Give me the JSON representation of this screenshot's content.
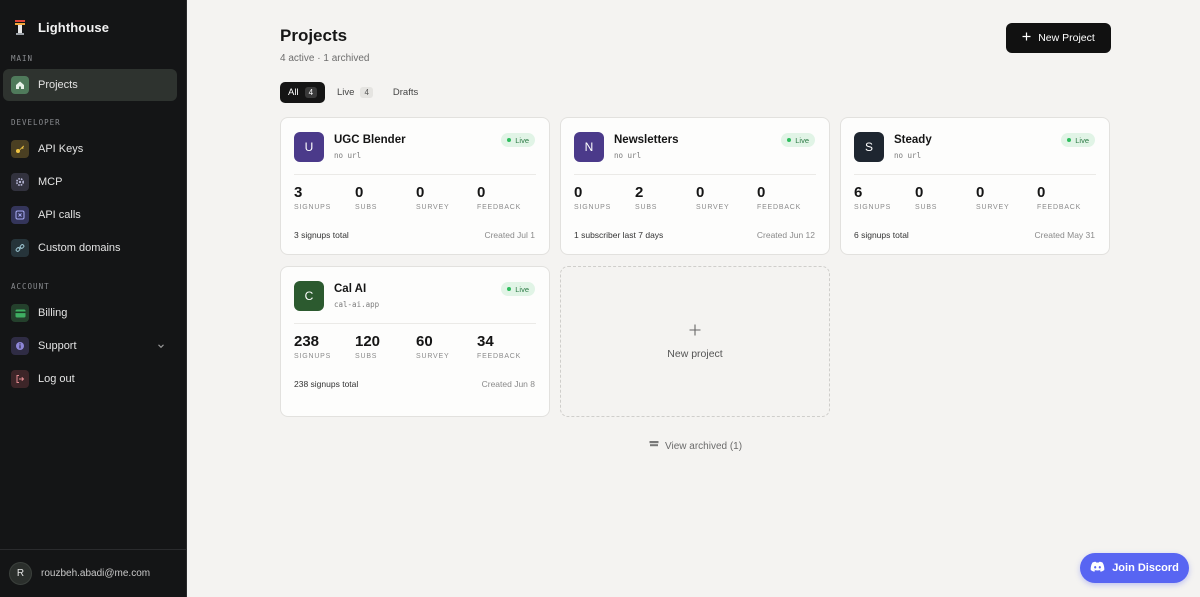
{
  "app": {
    "name": "Lighthouse"
  },
  "sidebar": {
    "sections": {
      "main": "MAIN",
      "developer": "DEVELOPER",
      "account": "ACCOUNT"
    },
    "items": {
      "projects": "Projects",
      "api_keys": "API Keys",
      "mcp": "MCP",
      "api_calls": "API calls",
      "custom_domains": "Custom domains",
      "billing": "Billing",
      "support": "Support",
      "log_out": "Log out"
    },
    "user": {
      "initial": "R",
      "email": "rouzbeh.abadi@me.com"
    }
  },
  "header": {
    "title": "Projects",
    "subtitle": "4 active · 1 archived",
    "new_project_label": "New Project"
  },
  "tabs": [
    {
      "label": "All",
      "count": "4"
    },
    {
      "label": "Live",
      "count": "4"
    },
    {
      "label": "Drafts"
    }
  ],
  "projects": [
    {
      "initial": "U",
      "name": "UGC Blender",
      "url": "no url",
      "status": "Live",
      "color": "#4b3a8a",
      "stats": [
        {
          "value": "3",
          "label": "SIGNUPS"
        },
        {
          "value": "0",
          "label": "SUBS"
        },
        {
          "value": "0",
          "label": "SURVEY"
        },
        {
          "value": "0",
          "label": "FEEDBACK"
        }
      ],
      "summary": "3 signups total",
      "created": "Created Jul 1"
    },
    {
      "initial": "N",
      "name": "Newsletters",
      "url": "no url",
      "status": "Live",
      "color": "#4b3a8a",
      "stats": [
        {
          "value": "0",
          "label": "SIGNUPS"
        },
        {
          "value": "2",
          "label": "SUBS"
        },
        {
          "value": "0",
          "label": "SURVEY"
        },
        {
          "value": "0",
          "label": "FEEDBACK"
        }
      ],
      "summary": "1 subscriber last 7 days",
      "created": "Created Jun 12"
    },
    {
      "initial": "S",
      "name": "Steady",
      "url": "no url",
      "status": "Live",
      "color": "#1e2630",
      "stats": [
        {
          "value": "6",
          "label": "SIGNUPS"
        },
        {
          "value": "0",
          "label": "SUBS"
        },
        {
          "value": "0",
          "label": "SURVEY"
        },
        {
          "value": "0",
          "label": "FEEDBACK"
        }
      ],
      "summary": "6 signups total",
      "created": "Created May 31"
    },
    {
      "initial": "C",
      "name": "Cal AI",
      "url": "cal-ai.app",
      "status": "Live",
      "color": "#2c5a2f",
      "stats": [
        {
          "value": "238",
          "label": "SIGNUPS"
        },
        {
          "value": "120",
          "label": "SUBS"
        },
        {
          "value": "60",
          "label": "SURVEY"
        },
        {
          "value": "34",
          "label": "FEEDBACK"
        }
      ],
      "summary": "238 signups total",
      "created": "Created Jun 8"
    }
  ],
  "new_project_card": {
    "label": "New project"
  },
  "view_archived": {
    "label": "View archived (1)"
  },
  "discord": {
    "label": "Join Discord"
  },
  "colors": {
    "accent": "#5865f2",
    "live_green": "#2dbd5d",
    "sidebar_bg": "#141516"
  }
}
